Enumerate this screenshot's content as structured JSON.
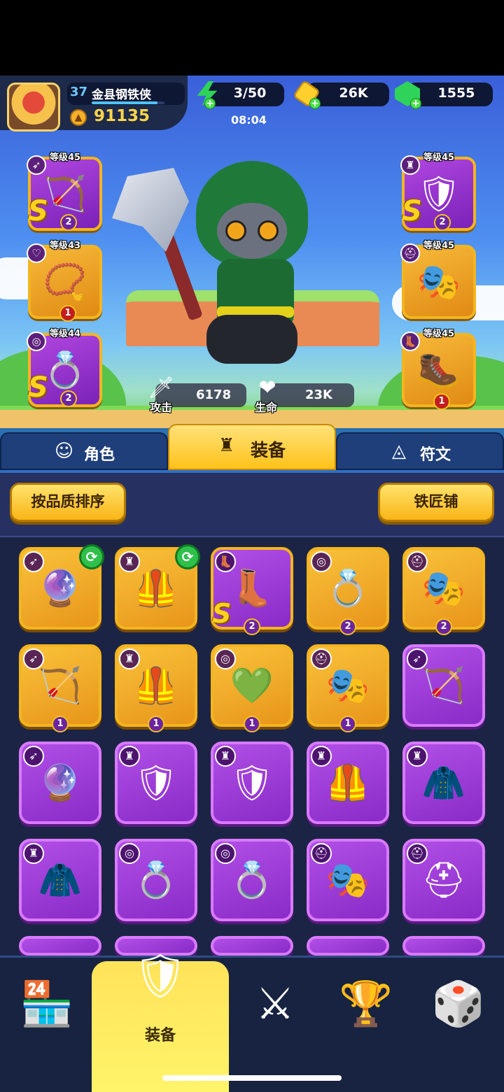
{
  "player": {
    "level": "37",
    "name": "金县钢铁侠",
    "power": "91135",
    "xp_fraction": 0.9
  },
  "resources": {
    "energy": "3/50",
    "energy_timer": "08:04",
    "coins": "26K",
    "gems": "1555"
  },
  "equipped_left": [
    {
      "level_label": "等级45",
      "slot_icon": "bow",
      "item": "winged-crossbow",
      "rank": "S",
      "stars": "2",
      "frame": "purple"
    },
    {
      "level_label": "等级43",
      "slot_icon": "necklace",
      "item": "blue-necklace",
      "rank": "",
      "stars": "1",
      "frame": "gold"
    },
    {
      "level_label": "等级44",
      "slot_icon": "ring",
      "item": "lion-ring",
      "rank": "S",
      "stars": "2",
      "frame": "purple"
    }
  ],
  "equipped_right": [
    {
      "level_label": "等级45",
      "slot_icon": "armor",
      "item": "dark-armor",
      "rank": "S",
      "stars": "2",
      "frame": "purple"
    },
    {
      "level_label": "等级45",
      "slot_icon": "helmet",
      "item": "blue-mask",
      "rank": "",
      "stars": "",
      "frame": "gold"
    },
    {
      "level_label": "等级45",
      "slot_icon": "boots",
      "item": "teal-boots",
      "rank": "",
      "stars": "1",
      "frame": "gold"
    }
  ],
  "stats": {
    "attack_label": "攻击",
    "attack_value": "6178",
    "hp_label": "生命",
    "hp_value": "23K"
  },
  "tabs": {
    "hero": "角色",
    "equipment": "装备",
    "runes": "符文"
  },
  "toolbar": {
    "sort_label": "按品质排序",
    "smith_label": "铁匠铺"
  },
  "inventory": [
    {
      "item": "blue-staff",
      "slot_icon": "bow",
      "frame": "gold",
      "stars": "",
      "refresh": true,
      "rank": ""
    },
    {
      "item": "teal-armor",
      "slot_icon": "armor",
      "frame": "gold",
      "stars": "",
      "refresh": true,
      "rank": ""
    },
    {
      "item": "winged-boot",
      "slot_icon": "boots",
      "frame": "purple",
      "stars": "2",
      "refresh": false,
      "rank": "S"
    },
    {
      "item": "star-ring",
      "slot_icon": "ring",
      "frame": "gold",
      "stars": "2",
      "refresh": false,
      "rank": ""
    },
    {
      "item": "blue-mask",
      "slot_icon": "helmet",
      "frame": "gold",
      "stars": "2",
      "refresh": false,
      "rank": ""
    },
    {
      "item": "red-bow",
      "slot_icon": "bow",
      "frame": "gold",
      "stars": "1",
      "refresh": false,
      "rank": ""
    },
    {
      "item": "teal-armor",
      "slot_icon": "armor",
      "frame": "gold",
      "stars": "1",
      "refresh": false,
      "rank": ""
    },
    {
      "item": "green-ring",
      "slot_icon": "ring",
      "frame": "gold",
      "stars": "1",
      "refresh": false,
      "rank": ""
    },
    {
      "item": "dark-mask",
      "slot_icon": "helmet",
      "frame": "gold",
      "stars": "1",
      "refresh": false,
      "rank": ""
    },
    {
      "item": "red-bow",
      "slot_icon": "bow",
      "frame": "plain",
      "stars": "",
      "refresh": false,
      "rank": ""
    },
    {
      "item": "blue-staff",
      "slot_icon": "bow",
      "frame": "plain",
      "stars": "",
      "refresh": false,
      "rank": ""
    },
    {
      "item": "caped-armor",
      "slot_icon": "armor",
      "frame": "plain",
      "stars": "",
      "refresh": false,
      "rank": ""
    },
    {
      "item": "caped-armor",
      "slot_icon": "armor",
      "frame": "plain",
      "stars": "",
      "refresh": false,
      "rank": ""
    },
    {
      "item": "teal-armor",
      "slot_icon": "armor",
      "frame": "plain",
      "stars": "",
      "refresh": false,
      "rank": ""
    },
    {
      "item": "orange-armor",
      "slot_icon": "armor",
      "frame": "plain",
      "stars": "",
      "refresh": false,
      "rank": ""
    },
    {
      "item": "orange-armor",
      "slot_icon": "armor",
      "frame": "plain",
      "stars": "",
      "refresh": false,
      "rank": ""
    },
    {
      "item": "star-ring",
      "slot_icon": "ring",
      "frame": "plain",
      "stars": "",
      "refresh": false,
      "rank": ""
    },
    {
      "item": "orange-ring",
      "slot_icon": "ring",
      "frame": "plain",
      "stars": "",
      "refresh": false,
      "rank": ""
    },
    {
      "item": "dark-mask",
      "slot_icon": "helmet",
      "frame": "plain",
      "stars": "",
      "refresh": false,
      "rank": ""
    },
    {
      "item": "gold-helmet",
      "slot_icon": "helmet",
      "frame": "plain",
      "stars": "",
      "refresh": false,
      "rank": ""
    }
  ],
  "bottom_nav": {
    "items": [
      "shop",
      "equipment",
      "battle",
      "trophy",
      "board"
    ],
    "active_label": "装备"
  },
  "colors": {
    "accent": "#ffc21a",
    "frame_gold": "#f3b51f",
    "frame_purple": "#b14fe6",
    "background": "#1c2446"
  }
}
